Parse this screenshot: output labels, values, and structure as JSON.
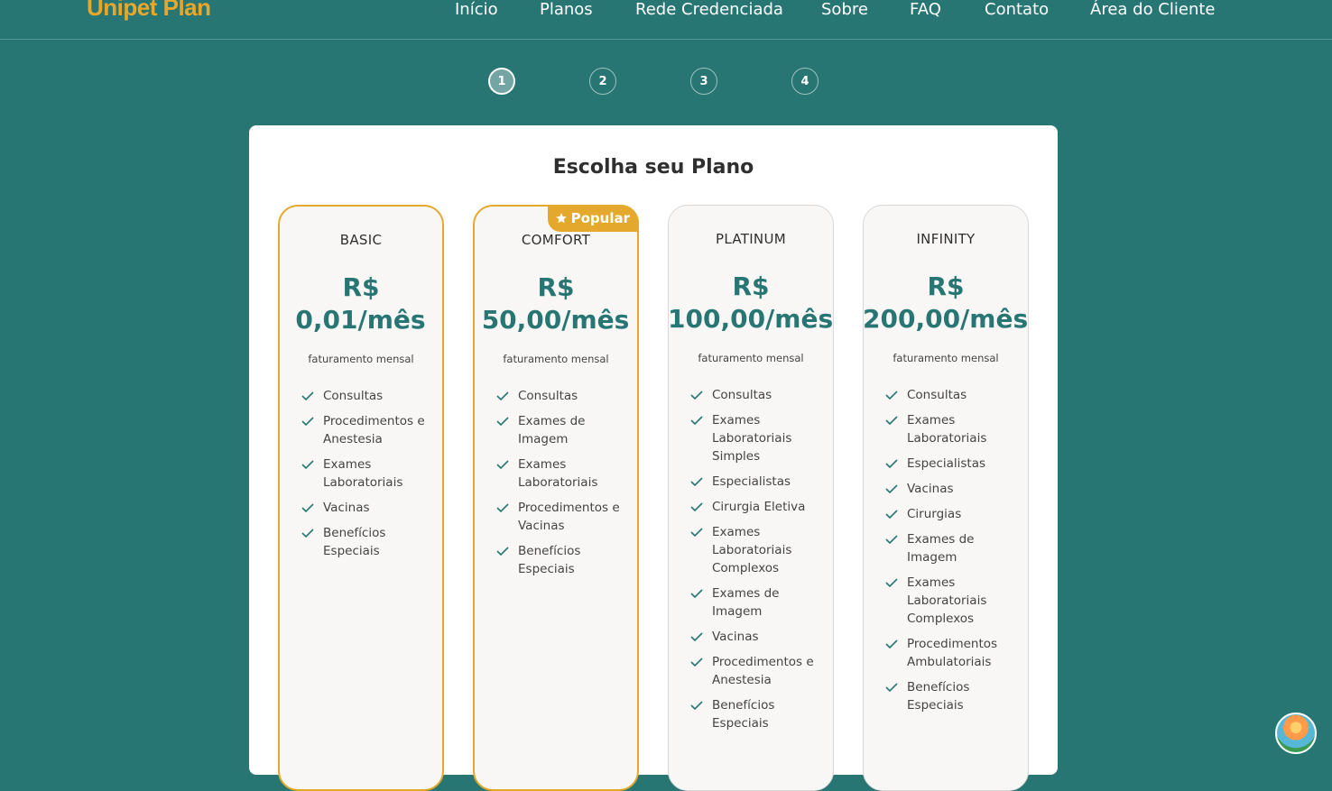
{
  "header": {
    "logo": "Unipet Plan",
    "nav": [
      "Início",
      "Planos",
      "Rede Credenciada",
      "Sobre",
      "FAQ",
      "Contato",
      "Área do Cliente"
    ]
  },
  "steps": [
    "1",
    "2",
    "3",
    "4"
  ],
  "panel": {
    "title": "Escolha seu Plano"
  },
  "plans": [
    {
      "name": "BASIC",
      "currency": "R$",
      "amount": "0,01/mês",
      "billing": "faturamento mensal",
      "features": [
        "Consultas",
        "Procedimentos e Anestesia",
        "Exames Laboratoriais",
        "Vacinas",
        "Benefícios Especiais"
      ]
    },
    {
      "name": "COMFORT",
      "currency": "R$",
      "amount": "50,00/mês",
      "billing": "faturamento mensal",
      "badge": "Popular",
      "features": [
        "Consultas",
        "Exames de Imagem",
        "Exames Laboratoriais",
        "Procedimentos e Vacinas",
        "Benefícios Especiais"
      ]
    },
    {
      "name": "PLATINUM",
      "currency": "R$",
      "amount": "100,00/mês",
      "billing": "faturamento mensal",
      "features": [
        "Consultas",
        "Exames Laboratoriais Simples",
        "Especialistas",
        "Cirurgia Eletiva",
        "Exames Laboratoriais Complexos",
        "Exames de Imagem",
        "Vacinas",
        "Procedimentos e Anestesia",
        "Benefícios Especiais"
      ]
    },
    {
      "name": "INFINITY",
      "currency": "R$",
      "amount": "200,00/mês",
      "billing": "faturamento mensal",
      "features": [
        "Consultas",
        "Exames Laboratoriais",
        "Especialistas",
        "Vacinas",
        "Cirurgias",
        "Exames de Imagem",
        "Exames Laboratoriais Complexos",
        "Procedimentos Ambulatoriais",
        "Benefícios Especiais"
      ]
    }
  ],
  "colors": {
    "brand_teal": "#287674",
    "accent_gold": "#e4a92c",
    "check": "#287674"
  }
}
